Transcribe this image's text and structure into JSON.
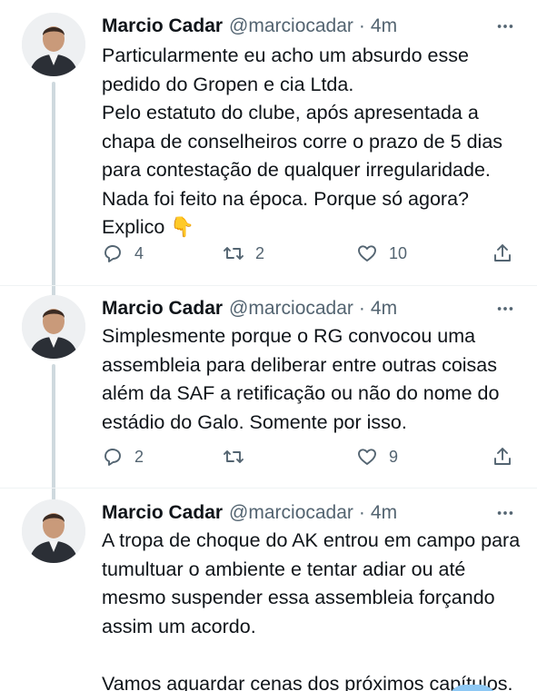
{
  "tweets": [
    {
      "author": "Marcio Cadar",
      "handle": "@marciocadar",
      "separator": "·",
      "time": "4m",
      "lines": [
        "Particularmente eu acho um absurdo esse",
        "pedido do Gropen e cia Ltda.",
        "Pelo estatuto do clube, após apresentada a",
        "chapa de conselheiros corre o prazo de 5 dias",
        "para contestação de qualquer irregularidade.",
        "Nada foi feito na época. Porque só agora?",
        "Explico"
      ],
      "emoji": "👇",
      "replies": "4",
      "retweets": "2",
      "likes": "10"
    },
    {
      "author": "Marcio Cadar",
      "handle": "@marciocadar",
      "separator": "·",
      "time": "4m",
      "lines": [
        "Simplesmente porque o RG convocou uma",
        "assembleia para deliberar entre outras coisas",
        "além da SAF a retificação ou não do nome do",
        "estádio do Galo. Somente por isso."
      ],
      "replies": "2",
      "retweets": "",
      "likes": "9"
    },
    {
      "author": "Marcio Cadar",
      "handle": "@marciocadar",
      "separator": "·",
      "time": "4m",
      "lines": [
        "A tropa de choque do AK entrou em campo para",
        "tumultuar o ambiente e tentar adiar ou até",
        "mesmo suspender essa assembleia forçando",
        "assim um acordo."
      ],
      "closing": "Vamos aguardar cenas dos próximos capítulos."
    }
  ],
  "icons": {
    "reply": "reply-icon",
    "retweet": "retweet-icon",
    "like": "heart-icon",
    "share": "share-icon",
    "more": "more-icon"
  },
  "colors": {
    "text": "#0f1419",
    "secondary": "#536471",
    "thread_line": "#cfd9de",
    "divider": "#eff3f4"
  }
}
